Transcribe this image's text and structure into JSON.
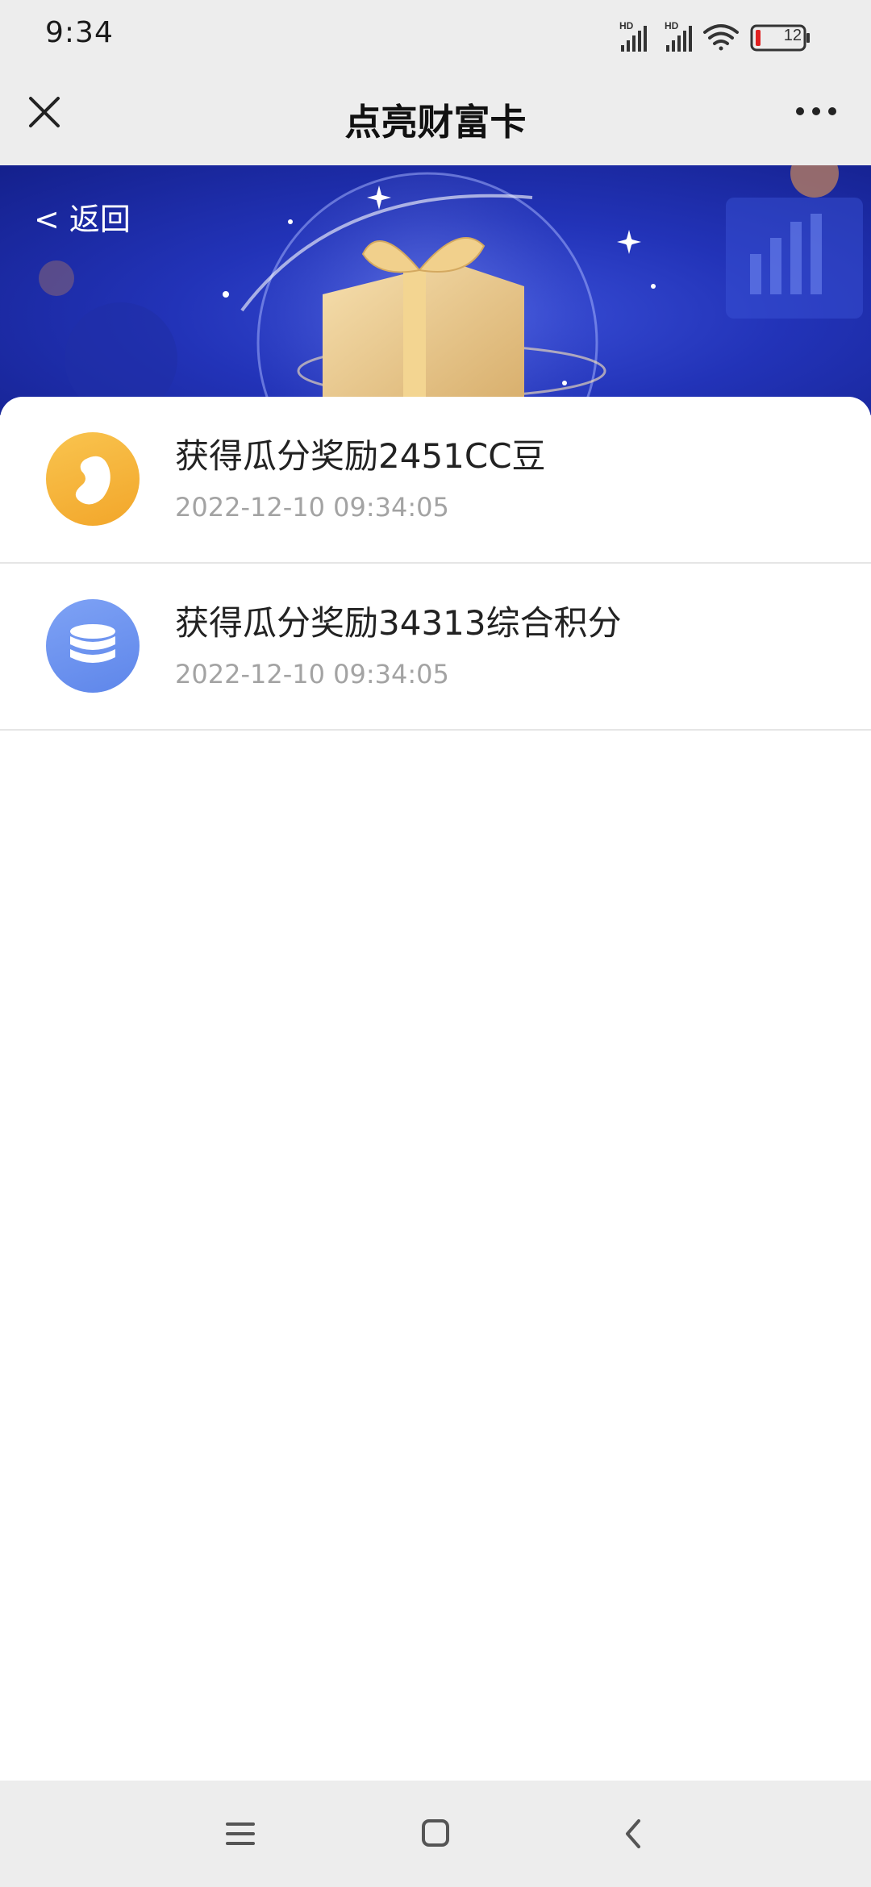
{
  "status_bar": {
    "time": "9:34",
    "battery_level": "12",
    "icons": [
      "hd-signal-icon",
      "hd-signal-icon",
      "wifi-icon",
      "battery-icon"
    ]
  },
  "nav": {
    "title": "点亮财富卡",
    "close_icon": "close-icon",
    "more_icon": "more-icon"
  },
  "banner": {
    "back_label": "< 返回"
  },
  "records": [
    {
      "title": "获得瓜分奖励2451CC豆",
      "time": "2022-12-10 09:34:05",
      "icon": "bean-icon",
      "color": "#F5B13A"
    },
    {
      "title": "获得瓜分奖励34313综合积分",
      "time": "2022-12-10 09:34:05",
      "icon": "coins-icon",
      "color": "#6E93EE"
    }
  ],
  "bottom_nav": {
    "icons": [
      "menu-icon",
      "home-icon",
      "back-icon"
    ]
  }
}
